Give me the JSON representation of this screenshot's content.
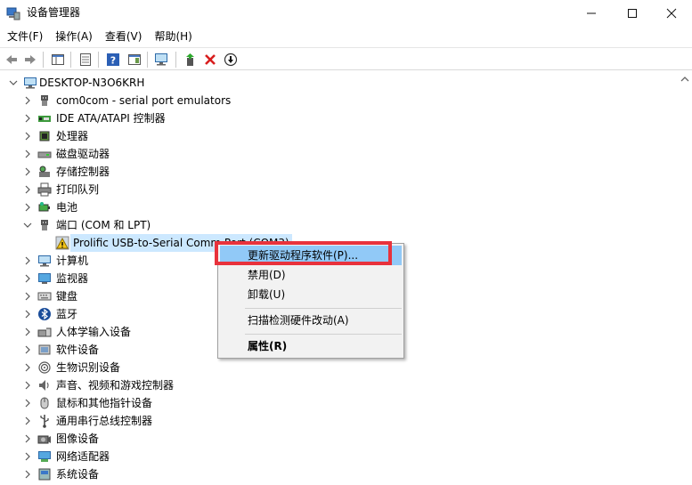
{
  "window": {
    "title": "设备管理器",
    "icons": {
      "app": "device-manager-icon",
      "minimize": "minimize-icon",
      "maximize": "maximize-icon",
      "close": "close-icon"
    }
  },
  "menubar": {
    "items": [
      {
        "label": "文件(F)"
      },
      {
        "label": "操作(A)"
      },
      {
        "label": "查看(V)"
      },
      {
        "label": "帮助(H)"
      }
    ]
  },
  "toolbar": {
    "buttons": [
      {
        "icon": "back-arrow-icon"
      },
      {
        "icon": "forward-arrow-icon"
      },
      {
        "icon": "show-hide-console-tree-icon"
      },
      {
        "icon": "properties-icon"
      },
      {
        "icon": "help-icon"
      },
      {
        "icon": "action-pane-icon"
      },
      {
        "icon": "scan-hardware-icon"
      },
      {
        "icon": "update-driver-icon"
      },
      {
        "icon": "uninstall-device-icon"
      },
      {
        "icon": "disable-device-icon"
      }
    ]
  },
  "tree": {
    "root": {
      "label": "DESKTOP-N3O6KRH",
      "icon": "computer-icon",
      "expanded": true
    },
    "items": [
      {
        "label": "com0com - serial port emulators",
        "icon": "port-icon",
        "expanded": false
      },
      {
        "label": "IDE ATA/ATAPI 控制器",
        "icon": "ide-controller-icon",
        "expanded": false
      },
      {
        "label": "处理器",
        "icon": "processor-icon",
        "expanded": false
      },
      {
        "label": "磁盘驱动器",
        "icon": "disk-drive-icon",
        "expanded": false
      },
      {
        "label": "存储控制器",
        "icon": "storage-controller-icon",
        "expanded": false
      },
      {
        "label": "打印队列",
        "icon": "printer-icon",
        "expanded": false
      },
      {
        "label": "电池",
        "icon": "battery-icon",
        "expanded": false
      },
      {
        "label": "端口 (COM 和 LPT)",
        "icon": "port-icon",
        "expanded": true
      },
      {
        "label": "Prolific USB-to-Serial Comm Port (COM3)",
        "icon": "warning-icon",
        "child": true,
        "selected": true
      },
      {
        "label": "计算机",
        "icon": "computer-icon",
        "expanded": false
      },
      {
        "label": "监视器",
        "icon": "monitor-icon",
        "expanded": false
      },
      {
        "label": "键盘",
        "icon": "keyboard-icon",
        "expanded": false
      },
      {
        "label": "蓝牙",
        "icon": "bluetooth-icon",
        "expanded": false
      },
      {
        "label": "人体学输入设备",
        "icon": "hid-icon",
        "expanded": false
      },
      {
        "label": "软件设备",
        "icon": "software-device-icon",
        "expanded": false
      },
      {
        "label": "生物识别设备",
        "icon": "fingerprint-icon",
        "expanded": false
      },
      {
        "label": "声音、视频和游戏控制器",
        "icon": "speaker-icon",
        "expanded": false
      },
      {
        "label": "鼠标和其他指针设备",
        "icon": "mouse-icon",
        "expanded": false
      },
      {
        "label": "通用串行总线控制器",
        "icon": "usb-icon",
        "expanded": false
      },
      {
        "label": "图像设备",
        "icon": "camera-icon",
        "expanded": false
      },
      {
        "label": "网络适配器",
        "icon": "network-adapter-icon",
        "expanded": false
      },
      {
        "label": "系统设备",
        "icon": "system-device-icon",
        "expanded": false
      }
    ]
  },
  "context_menu": {
    "items": [
      {
        "label": "更新驱动程序软件(P)...",
        "highlighted": true
      },
      {
        "label": "禁用(D)"
      },
      {
        "label": "卸载(U)"
      },
      {
        "label": "扫描检测硬件改动(A)"
      },
      {
        "label": "属性(R)",
        "bold": true
      }
    ]
  },
  "colors": {
    "highlight": "#91c9f7",
    "selection": "#cce8ff",
    "annotation_box": "#e8323c"
  }
}
